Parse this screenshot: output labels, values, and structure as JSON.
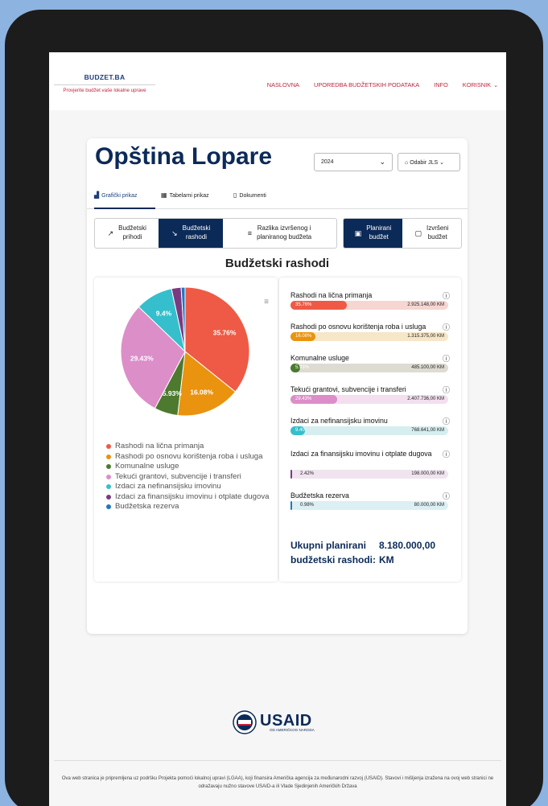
{
  "site": {
    "brand": "BUDZET.BA",
    "tagline": "Provjerite budžet vaše lokalne uprave",
    "nav": [
      "NASLOVNA",
      "UPOREDBA BUDŽETSKIH PODATAKA",
      "INFO",
      "KORISNIK"
    ]
  },
  "page": {
    "title": "Opština Lopare",
    "year_select": "2024",
    "jls_select": "Odabir JLS",
    "tabs": [
      "Grafički prikaz",
      "Tabelarni prikaz",
      "Dokumenti"
    ],
    "segments_left": [
      {
        "line1": "Budžetski",
        "line2": "prihodi",
        "active": false
      },
      {
        "line1": "Budžetski",
        "line2": "rashodi",
        "active": true
      },
      {
        "line1": "Razlika izvršenog i",
        "line2": "planiranog budžeta",
        "active": false
      }
    ],
    "segments_right": [
      {
        "line1": "Planirani",
        "line2": "budžet",
        "active": true
      },
      {
        "line1": "Izvršeni",
        "line2": "budžet",
        "active": false
      }
    ],
    "section_title": "Budžetski rashodi",
    "total_label": "Ukupni planirani budžetski rashodi:",
    "total_value": "8.180.000,00 KM"
  },
  "chart_data": {
    "type": "pie",
    "labels": [
      "Rashodi na lična primanja",
      "Rashodi po osnovu korištenja roba i usluga",
      "Komunalne usluge",
      "Tekući grantovi, subvencije i transferi",
      "Izdaci za nefinansijsku imovinu",
      "Izdaci za finansijsku imovinu i otplate dugova",
      "Budžetska rezerva"
    ],
    "values": [
      35.76,
      16.08,
      5.93,
      29.43,
      9.4,
      2.42,
      0.98
    ],
    "slice_labels": [
      "35.76%",
      "16.08%",
      "5.93%",
      "29.43%",
      "9.4%",
      "",
      ""
    ],
    "amounts": [
      "2.925.148,00 KM",
      "1.315.375,00 KM",
      "485.100,00 KM",
      "2.407.736,00 KM",
      "768.641,00 KM",
      "198.000,00 KM",
      "80.000,00 KM"
    ],
    "bar_pct_labels": [
      "35.76%",
      "16.08%",
      "5.93%",
      "29.43%",
      "9.40",
      "2.42%",
      "0.98%"
    ],
    "colors": [
      "#ee5a45",
      "#e9930e",
      "#4d7a2f",
      "#dc8ec8",
      "#35bfcc",
      "#7a3a82",
      "#1f78c2"
    ],
    "bar_bg_colors": [
      "#f6d6d1",
      "#f7e6c8",
      "#dedcd2",
      "#f3dff0",
      "#d6eeef",
      "#efe4ef",
      "#dceff2"
    ],
    "legend_placement": "bottom"
  }
}
